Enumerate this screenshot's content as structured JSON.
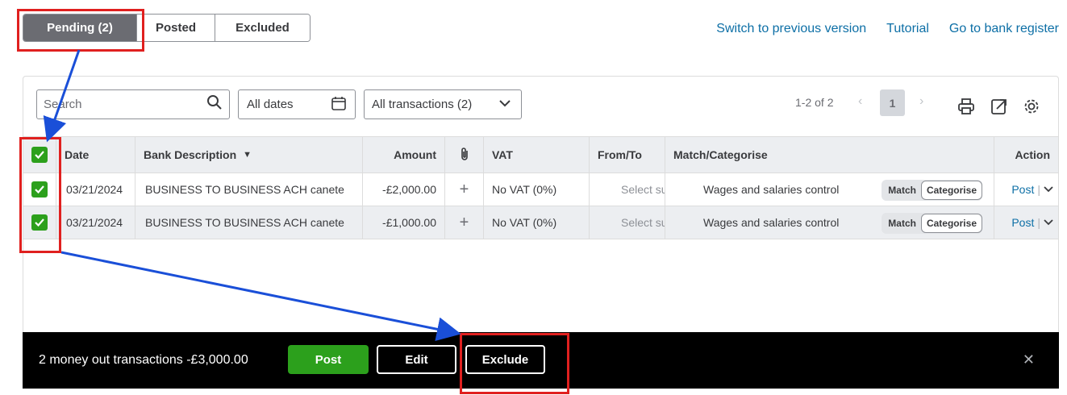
{
  "tabs": [
    {
      "label": "Pending (2)",
      "active": true
    },
    {
      "label": "Posted",
      "active": false
    },
    {
      "label": "Excluded",
      "active": false
    }
  ],
  "top_links": {
    "switch": "Switch to previous version",
    "tutorial": "Tutorial",
    "register": "Go to bank register"
  },
  "filters": {
    "search_placeholder": "Search",
    "dates": "All dates",
    "transactions": "All transactions (2)"
  },
  "pager": {
    "info": "1-2 of 2",
    "current_page": "1"
  },
  "table": {
    "headers": {
      "date": "Date",
      "description": "Bank Description",
      "amount": "Amount",
      "vat": "VAT",
      "from_to": "From/To",
      "match": "Match/Categorise",
      "action": "Action"
    },
    "rows": [
      {
        "checked": true,
        "date": "03/21/2024",
        "description": "BUSINESS TO BUSINESS ACH canete",
        "amount": "-£2,000.00",
        "vat": "No VAT (0%)",
        "from_to": "Select su",
        "category": "Wages and salaries control",
        "match_label": "Match",
        "categorise_label": "Categorise",
        "action": "Post"
      },
      {
        "checked": true,
        "date": "03/21/2024",
        "description": "BUSINESS TO BUSINESS ACH canete",
        "amount": "-£1,000.00",
        "vat": "No VAT (0%)",
        "from_to": "Select su",
        "category": "Wages and salaries control",
        "match_label": "Match",
        "categorise_label": "Categorise",
        "action": "Post"
      }
    ]
  },
  "bottom_bar": {
    "summary": "2 money out transactions -£3,000.00",
    "post": "Post",
    "edit": "Edit",
    "exclude": "Exclude"
  },
  "colors": {
    "accent_green": "#2ca01c",
    "link_blue": "#0d6fa6",
    "annotation_red": "#e0201f",
    "arrow_blue": "#1a4fd8"
  }
}
